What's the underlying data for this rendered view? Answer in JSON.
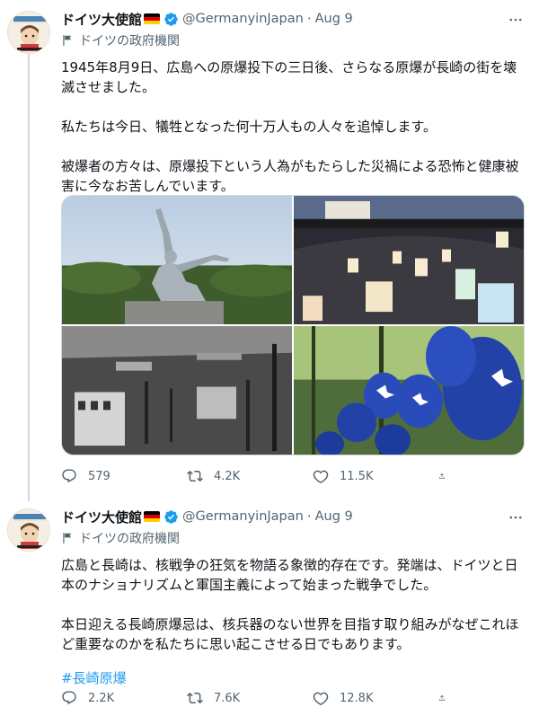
{
  "tweets": [
    {
      "display_name": "ドイツ大使館",
      "handle": "@GermanyinJapan",
      "time": "Aug 9",
      "label": "ドイツの政府機関",
      "paragraphs": [
        "1945年8月9日、広島への原爆投下の三日後、さらなる原爆が長崎の街を壊滅させました。",
        "私たちは今日、犠牲となった何十万人もの人々を追悼します。",
        "被爆者の方々は、原爆投下という人為がもたらした災禍による恐怖と健康被害に今なお苦しんでいます。"
      ],
      "replies": "579",
      "retweets": "4.2K",
      "likes": "11.5K"
    },
    {
      "display_name": "ドイツ大使館",
      "handle": "@GermanyinJapan",
      "time": "Aug 9",
      "label": "ドイツの政府機関",
      "paragraphs": [
        "広島と長崎は、核戦争の狂気を物語る象徴的存在です。発端は、ドイツと日本のナショナリズムと軍国主義によって始まった戦争でした。",
        "本日迎える長崎原爆忌は、核兵器のない世界を目指す取り組みがなぜこれほど重要なのかを私たちに思い起こさせる日でもあります。"
      ],
      "hashtag": "#長崎原爆",
      "replies": "2.2K",
      "retweets": "7.6K",
      "likes": "12.8K"
    }
  ],
  "icons": {
    "verified": "verified-badge-icon",
    "label": "government-flag-icon",
    "more": "more-icon",
    "reply": "reply-icon",
    "retweet": "retweet-icon",
    "like": "heart-icon",
    "share": "share-icon"
  },
  "colors": {
    "accent": "#1d9bf0",
    "secondary_text": "#536471",
    "flag_black": "#000000",
    "flag_red": "#dd0000",
    "flag_gold": "#ffce00"
  }
}
